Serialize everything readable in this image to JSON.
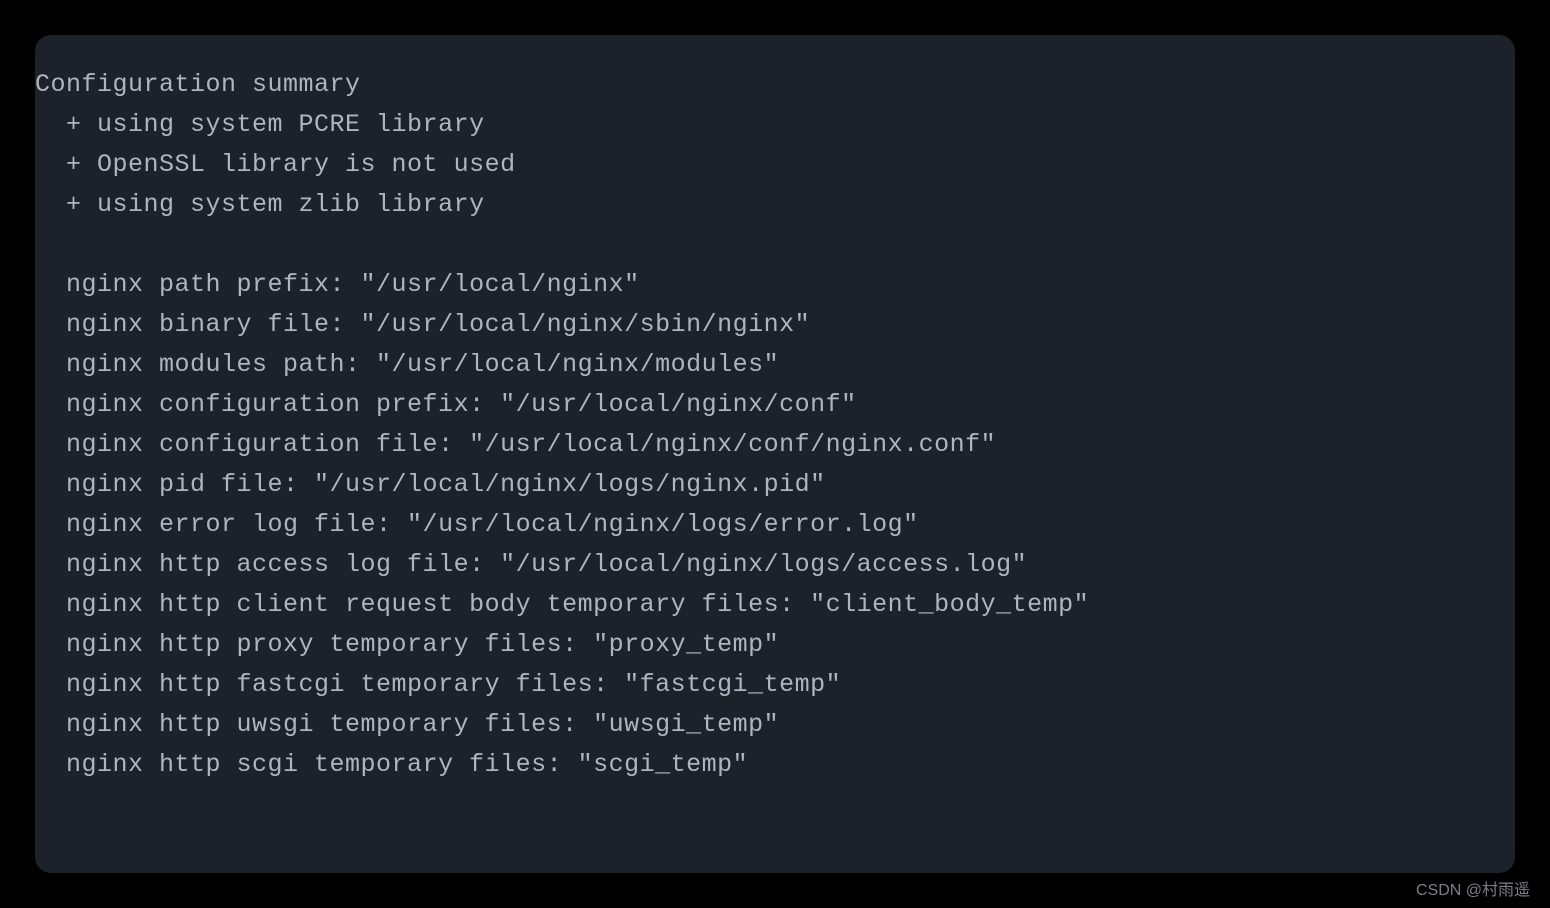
{
  "terminal": {
    "header": "Configuration summary",
    "libraries": [
      "  + using system PCRE library",
      "  + OpenSSL library is not used",
      "  + using system zlib library"
    ],
    "paths": [
      "  nginx path prefix: \"/usr/local/nginx\"",
      "  nginx binary file: \"/usr/local/nginx/sbin/nginx\"",
      "  nginx modules path: \"/usr/local/nginx/modules\"",
      "  nginx configuration prefix: \"/usr/local/nginx/conf\"",
      "  nginx configuration file: \"/usr/local/nginx/conf/nginx.conf\"",
      "  nginx pid file: \"/usr/local/nginx/logs/nginx.pid\"",
      "  nginx error log file: \"/usr/local/nginx/logs/error.log\"",
      "  nginx http access log file: \"/usr/local/nginx/logs/access.log\"",
      "  nginx http client request body temporary files: \"client_body_temp\"",
      "  nginx http proxy temporary files: \"proxy_temp\"",
      "  nginx http fastcgi temporary files: \"fastcgi_temp\"",
      "  nginx http uwsgi temporary files: \"uwsgi_temp\"",
      "  nginx http scgi temporary files: \"scgi_temp\""
    ]
  },
  "watermark": "CSDN @村雨遥"
}
